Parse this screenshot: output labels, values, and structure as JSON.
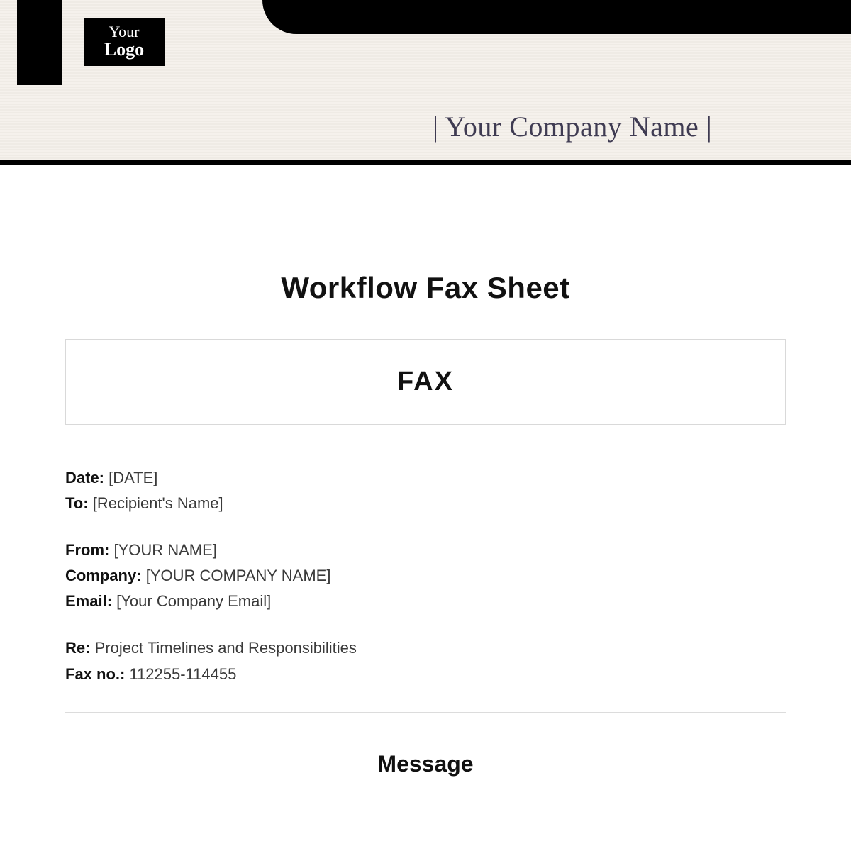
{
  "header": {
    "logo_line1": "Your",
    "logo_line2": "Logo",
    "company_name": "|  Your Company Name  |"
  },
  "document": {
    "title": "Workflow Fax Sheet",
    "fax_heading": "FAX",
    "message_heading": "Message"
  },
  "fields": {
    "date_label": "Date:",
    "date_value": "[DATE]",
    "to_label": "To:",
    "to_value": "[Recipient's Name]",
    "from_label": "From:",
    "from_value": "[YOUR NAME]",
    "company_label": "Company:",
    "company_value": "[YOUR COMPANY NAME]",
    "email_label": "Email:",
    "email_value": "[Your Company Email]",
    "re_label": "Re:",
    "re_value": "Project Timelines and Responsibilities",
    "faxno_label": "Fax no.:",
    "faxno_value": "112255-114455"
  }
}
